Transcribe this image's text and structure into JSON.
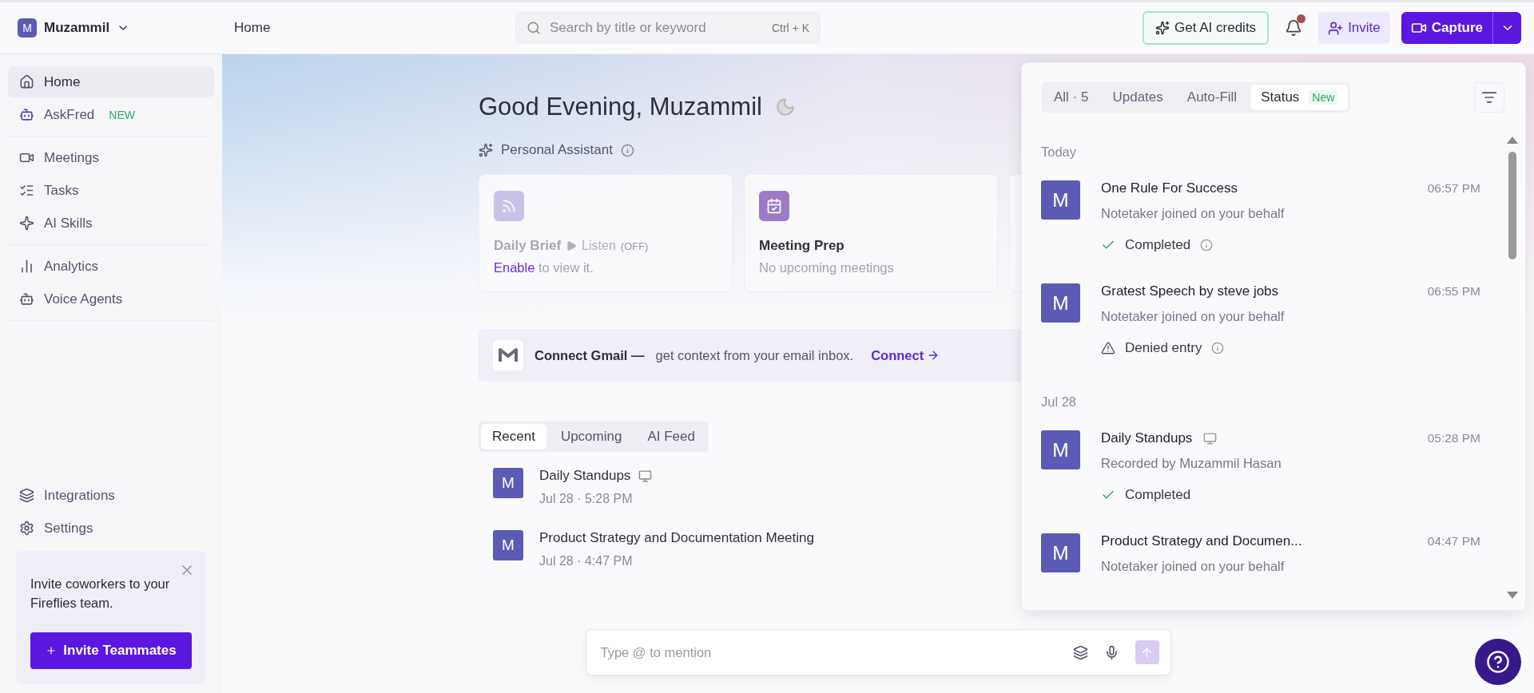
{
  "workspace": {
    "initial": "M",
    "name": "Muzammil"
  },
  "breadcrumb": "Home",
  "search": {
    "placeholder": "Search by title or keyword",
    "shortcut": "Ctrl + K"
  },
  "header_actions": {
    "ai_credits": "Get AI credits",
    "notification_dot": true,
    "invite": "Invite",
    "capture": "Capture"
  },
  "sidebar": {
    "sections": [
      {
        "items": [
          {
            "label": "Home",
            "selected": true
          },
          {
            "label": "AskFred",
            "selected": false,
            "badge": "NEW"
          }
        ]
      },
      {
        "items": [
          {
            "label": "Meetings",
            "selected": false
          },
          {
            "label": "Tasks",
            "selected": false
          },
          {
            "label": "AI Skills",
            "selected": false
          }
        ]
      },
      {
        "items": [
          {
            "label": "Analytics",
            "selected": false
          },
          {
            "label": "Voice Agents",
            "selected": false
          }
        ]
      }
    ],
    "bottom": [
      {
        "label": "Integrations",
        "selected": false
      },
      {
        "label": "Settings",
        "selected": false
      }
    ]
  },
  "invite_card": {
    "text": "Invite coworkers to your Fireflies team.",
    "button": "Invite Teammates"
  },
  "greeting": "Good Evening, Muzammil",
  "assistant": {
    "title": "Personal Assistant",
    "cards": [
      {
        "kind": "brief",
        "title": "Daily Brief",
        "listen": "Listen",
        "listen_state": "(OFF)",
        "link": "Enable",
        "text": "to view it."
      },
      {
        "kind": "prep",
        "title": "Meeting Prep",
        "text": "No upcoming meetings"
      },
      {
        "kind": "blank"
      }
    ]
  },
  "gmail": {
    "title": "Connect Gmail —",
    "text": "get context from your email inbox.",
    "action": "Connect"
  },
  "feed_tabs": [
    {
      "label": "Recent",
      "selected": true
    },
    {
      "label": "Upcoming",
      "selected": false
    },
    {
      "label": "AI Feed",
      "selected": false
    }
  ],
  "meetings": [
    {
      "avatar": "M",
      "title": "Daily Standups",
      "device": true,
      "when": "Jul 28 · 5:28 PM"
    },
    {
      "avatar": "M",
      "title": "Product Strategy and Documentation Meeting",
      "device": false,
      "when": "Jul 28 · 4:47 PM"
    }
  ],
  "chat": {
    "placeholder": "Type @ to mention"
  },
  "notifications": {
    "tabs": [
      {
        "label": "All · 5",
        "selected": false
      },
      {
        "label": "Updates",
        "selected": false
      },
      {
        "label": "Auto-Fill",
        "selected": false
      },
      {
        "label": "Status",
        "badge": "New",
        "selected": true
      }
    ],
    "groups": [
      {
        "date": "Today",
        "items": [
          {
            "avatar": "M",
            "title": "One Rule For Success",
            "device": false,
            "time": "06:57 PM",
            "subtitle": "Notetaker joined on your behalf",
            "status": {
              "kind": "completed",
              "label": "Completed",
              "info": true
            }
          },
          {
            "avatar": "M",
            "title": "Gratest Speech by steve jobs",
            "device": false,
            "time": "06:55 PM",
            "subtitle": "Notetaker joined on your behalf",
            "status": {
              "kind": "denied",
              "label": "Denied entry",
              "info": true
            }
          }
        ]
      },
      {
        "date": "Jul 28",
        "items": [
          {
            "avatar": "M",
            "title": "Daily Standups",
            "device": true,
            "time": "05:28 PM",
            "subtitle": "Recorded by Muzammil Hasan",
            "status": {
              "kind": "completed",
              "label": "Completed",
              "info": false
            }
          },
          {
            "avatar": "M",
            "title": "Product Strategy and Documen...",
            "device": false,
            "time": "04:47 PM",
            "subtitle": "Notetaker joined on your behalf"
          }
        ]
      }
    ]
  }
}
